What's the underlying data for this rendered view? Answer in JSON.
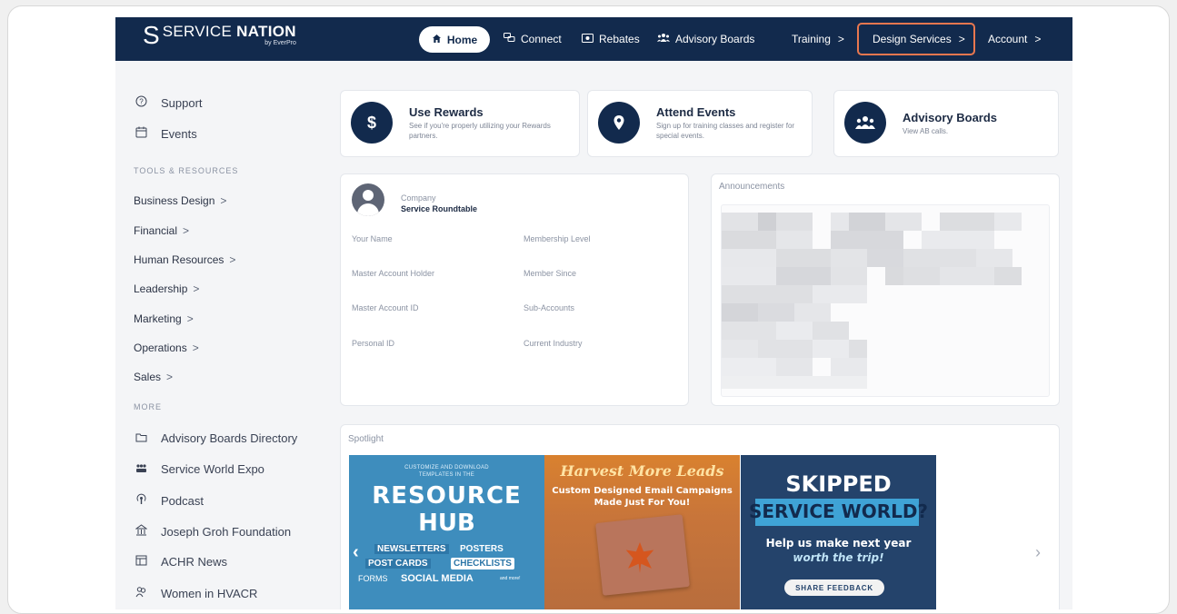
{
  "nav": {
    "logo_s": "S",
    "logo_service": "SERVICE",
    "logo_nation": "NATION",
    "logo_by": "by EverPro",
    "home": "Home",
    "connect": "Connect",
    "rebates": "Rebates",
    "advisory_boards": "Advisory Boards",
    "training": "Training",
    "design_services": "Design Services",
    "account": "Account",
    "chevron": ">"
  },
  "sidebar": {
    "top_links": [
      {
        "icon": "question-circle-icon",
        "label": "Support"
      },
      {
        "icon": "calendar-icon",
        "label": "Events"
      }
    ],
    "tools_heading": "TOOLS & RESOURCES",
    "categories": [
      "Business Design",
      "Financial",
      "Human Resources",
      "Leadership",
      "Marketing",
      "Operations",
      "Sales"
    ],
    "more_heading": "MORE",
    "more_links": [
      {
        "icon": "folder-icon",
        "label": "Advisory Boards Directory"
      },
      {
        "icon": "people-icon",
        "label": "Service World Expo"
      },
      {
        "icon": "podcast-icon",
        "label": "Podcast"
      },
      {
        "icon": "building-icon",
        "label": "Joseph Groh Foundation"
      },
      {
        "icon": "newspaper-icon",
        "label": "ACHR News"
      },
      {
        "icon": "women-icon",
        "label": "Women in HVACR"
      }
    ]
  },
  "quick_cards": [
    {
      "icon": "dollar-icon",
      "glyph": "$",
      "title": "Use Rewards",
      "desc": "See if you're properly utilizing your Rewards partners."
    },
    {
      "icon": "location-pin-icon",
      "glyph": "●",
      "title": "Attend Events",
      "desc": "Sign up for training classes and register for special events."
    },
    {
      "icon": "group-icon",
      "glyph": "👥",
      "title": "Advisory Boards",
      "desc": "View AB calls."
    }
  ],
  "profile": {
    "company_label": "Company",
    "company_value": "Service Roundtable",
    "fields": [
      "Your Name",
      "Membership Level",
      "Master Account Holder",
      "Member Since",
      "Master Account ID",
      "Sub-Accounts",
      "Personal ID",
      "Current Industry"
    ]
  },
  "announcements": {
    "title": "Announcements"
  },
  "spotlight": {
    "title": "Spotlight",
    "banner1": {
      "small_top": "CUSTOMIZE AND DOWNLOAD",
      "small_mid": "TEMPLATES IN THE",
      "big1": "RESOURCE",
      "big2": "HUB",
      "tag_newsletters": "NEWSLETTERS",
      "tag_posters": "POSTERS",
      "tag_postcards": "POST CARDS",
      "tag_checklists": "CHECKLISTS",
      "tag_forms": "FORMS",
      "tag_social": "SOCIAL MEDIA",
      "tag_more": "and more!"
    },
    "banner2": {
      "headline": "Harvest More Leads",
      "sub1": "Custom Designed Email Campaigns",
      "sub2": "Made Just For You!"
    },
    "banner3": {
      "line1": "SKIPPED",
      "line2": "SERVICE WORLD?",
      "line3": "Help us make next year",
      "line4": "worth the trip!",
      "button": "SHARE FEEDBACK"
    },
    "prev_arrow": "‹",
    "next_arrow": "›"
  }
}
